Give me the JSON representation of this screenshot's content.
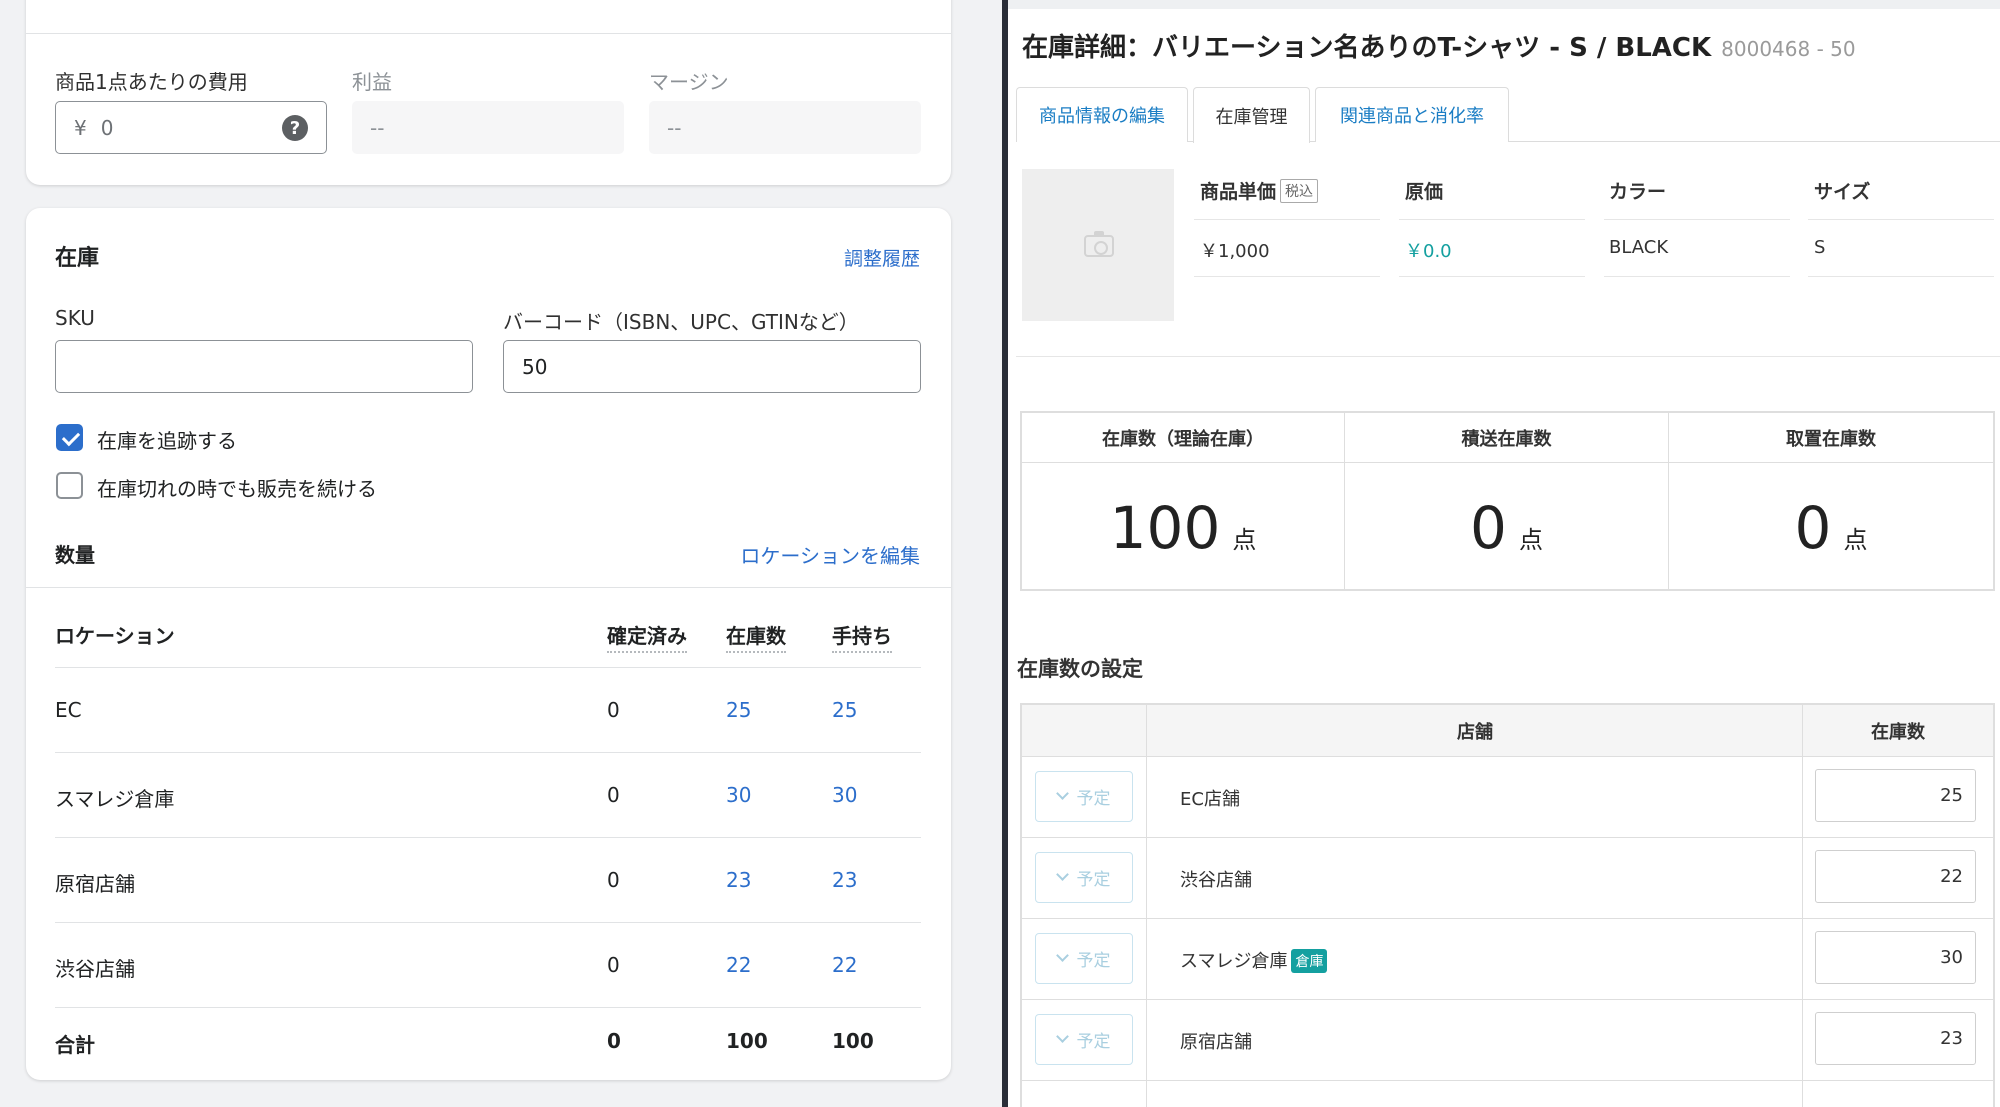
{
  "cost": {
    "cost_label": "商品1点あたりの費用",
    "currency": "¥",
    "cost_value": "0",
    "profit_label": "利益",
    "profit_value": "--",
    "margin_label": "マージン",
    "margin_value": "--"
  },
  "inventory": {
    "title": "在庫",
    "history_link": "調整履歴",
    "sku_label": "SKU",
    "sku_value": "",
    "barcode_label": "バーコード（ISBN、UPC、GTINなど）",
    "barcode_value": "50",
    "track_label": "在庫を追跡する",
    "track_checked": true,
    "continue_label": "在庫切れの時でも販売を続ける",
    "continue_checked": false,
    "quantity_title": "数量",
    "edit_locations_link": "ロケーションを編集",
    "columns": [
      "ロケーション",
      "確定済み",
      "在庫数",
      "手持ち"
    ],
    "rows": [
      {
        "location": "EC",
        "committed": "0",
        "available": "25",
        "on_hand": "25"
      },
      {
        "location": "スマレジ倉庫",
        "committed": "0",
        "available": "30",
        "on_hand": "30"
      },
      {
        "location": "原宿店舗",
        "committed": "0",
        "available": "23",
        "on_hand": "23"
      },
      {
        "location": "渋谷店舗",
        "committed": "0",
        "available": "22",
        "on_hand": "22"
      }
    ],
    "total": {
      "label": "合計",
      "committed": "0",
      "available": "100",
      "on_hand": "100"
    }
  },
  "detail": {
    "title": "在庫詳細：バリエーション名ありのT-シャツ - S / BLACK",
    "code": "8000468 - 50",
    "tabs": [
      "商品情報の編集",
      "在庫管理",
      "関連商品と消化率"
    ],
    "active_tab": "在庫管理",
    "attributes": {
      "price_label": "商品単価",
      "tax_badge": "税込",
      "price_value": "￥1,000",
      "cost_label": "原価",
      "cost_value": "￥0.0",
      "color_label": "カラー",
      "color_value": "BLACK",
      "size_label": "サイズ",
      "size_value": "S"
    },
    "stock_summary": [
      {
        "label": "在庫数（理論在庫）",
        "value": "100",
        "unit": "点"
      },
      {
        "label": "積送在庫数",
        "value": "0",
        "unit": "点"
      },
      {
        "label": "取置在庫数",
        "value": "0",
        "unit": "点"
      }
    ],
    "settings_title": "在庫数の設定",
    "settings_columns": {
      "store": "店舗",
      "qty": "在庫数"
    },
    "plan_button": "予定",
    "warehouse_badge": "倉庫",
    "settings_rows": [
      {
        "store": "EC店舗",
        "qty": "25",
        "warehouse": false
      },
      {
        "store": "渋谷店舗",
        "qty": "22",
        "warehouse": false
      },
      {
        "store": "スマレジ倉庫",
        "qty": "30",
        "warehouse": true
      },
      {
        "store": "原宿店舗",
        "qty": "23",
        "warehouse": false
      }
    ]
  },
  "colors": {
    "link": "#2c6ecb",
    "teal": "#14a0a0",
    "divider": "#2a2e38"
  }
}
